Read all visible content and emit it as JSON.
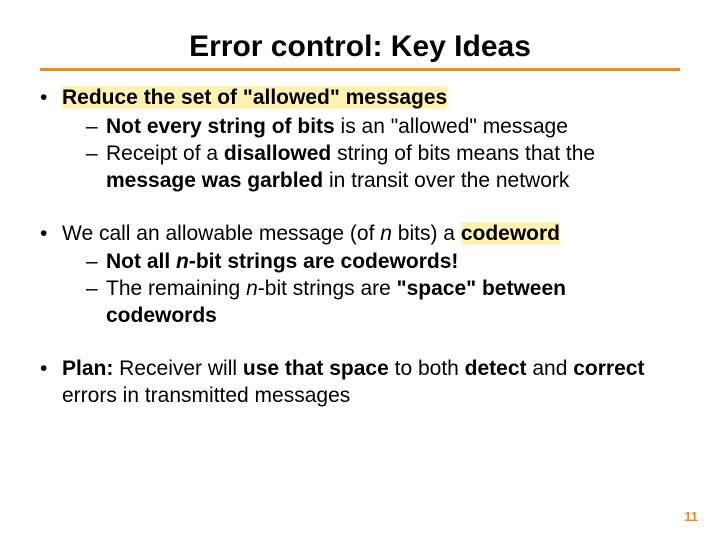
{
  "title": "Error control: Key Ideas",
  "b1": {
    "lead_hl": "Reduce the set of \"allowed\" messages",
    "s1_a": "Not every string of bits",
    "s1_b": " is an \"allowed\" message",
    "s2_a": "Receipt of a ",
    "s2_b": "disallowed",
    "s2_c": " string of bits means that the ",
    "s2_d": "message was garbled",
    "s2_e": " in transit over the network"
  },
  "b2": {
    "lead_a": "We call an allowable message (of ",
    "lead_n": "n",
    "lead_b": " bits) a ",
    "lead_c": "codeword",
    "s1_a": "Not all ",
    "s1_n": "n",
    "s1_b": "-bit strings are codewords!",
    "s2_a": "The remaining ",
    "s2_n": "n",
    "s2_b": "-bit strings are ",
    "s2_c": "\"space\" between codewords"
  },
  "b3": {
    "plan": "Plan:",
    "a": " Receiver will ",
    "b": "use that space",
    "c": " to both ",
    "d": "detect",
    "e": " and ",
    "f": "correct",
    "g": " errors in transmitted messages"
  },
  "page_number": "11"
}
